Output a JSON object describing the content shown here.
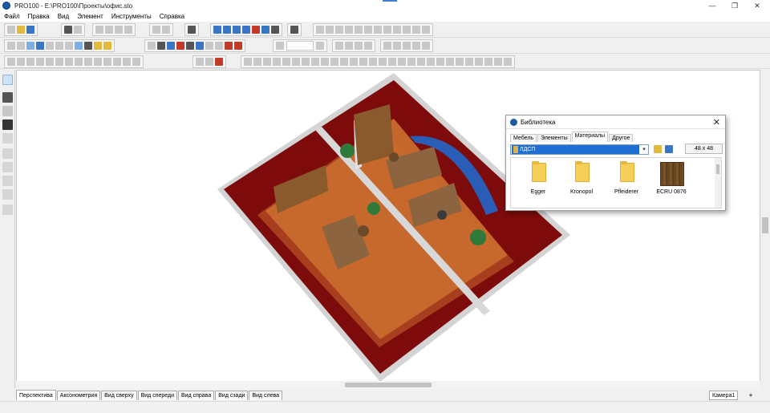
{
  "window": {
    "title": "PRO100 - E:\\PRO100\\Проекты\\офис.sto"
  },
  "menu": [
    "Файл",
    "Правка",
    "Вид",
    "Элемент",
    "Инструменты",
    "Справка"
  ],
  "view_tabs": [
    "Перспектива",
    "Аксонометрия",
    "Вид сверху",
    "Вид спереди",
    "Вид справа",
    "Вид сзади",
    "Вид слева"
  ],
  "camera_tab": "Камера1",
  "camera_add": "+",
  "library": {
    "title": "Библиотека",
    "close": "✕",
    "tabs": [
      "Мебель",
      "Элементы",
      "Материалы",
      "Другое"
    ],
    "selected_tab": "Материалы",
    "path": "ЛДСП",
    "size": "48 x 48",
    "items": [
      {
        "label": "Egger",
        "kind": "folder"
      },
      {
        "label": "Kronopol",
        "kind": "folder"
      },
      {
        "label": "Pfleiderer",
        "kind": "folder"
      },
      {
        "label": "ECRU 0876",
        "kind": "texture"
      }
    ]
  },
  "scene": {
    "floor_color": "#c5662a",
    "wall_color": "#8b0f0f",
    "wall_top": "#d9d9d9"
  }
}
